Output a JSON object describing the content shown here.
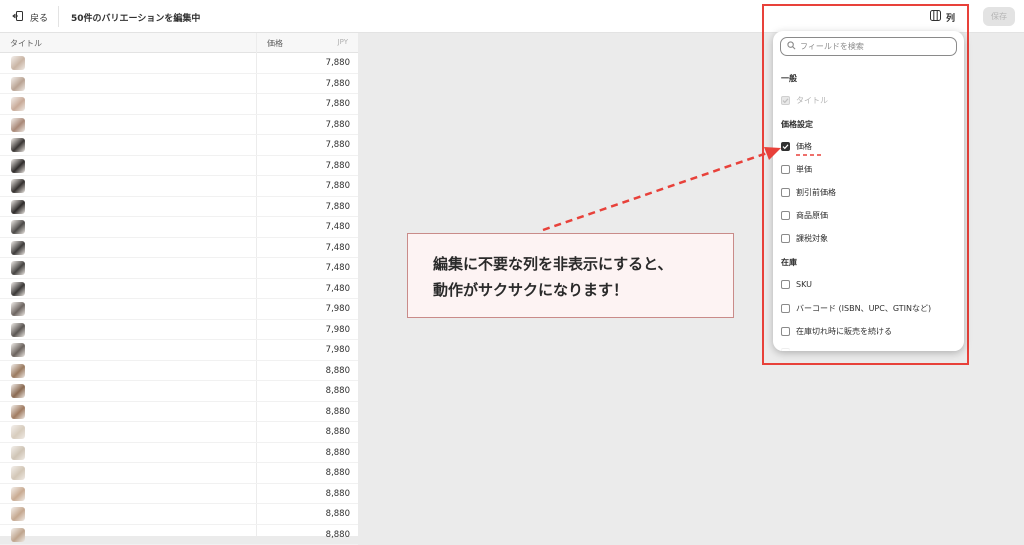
{
  "header": {
    "back_label": "戻る",
    "title": "50件のバリエーションを編集中",
    "columns_label": "列",
    "save_label": "保存"
  },
  "grid": {
    "col_title": "タイトル",
    "col_price": "価格",
    "currency": "JPY",
    "rows": [
      {
        "price": "7,880",
        "thumb": "#c9b4a4"
      },
      {
        "price": "7,880",
        "thumb": "#b9a393"
      },
      {
        "price": "7,880",
        "thumb": "#c8aa98"
      },
      {
        "price": "7,880",
        "thumb": "#a88877"
      },
      {
        "price": "7,880",
        "thumb": "#3a3634"
      },
      {
        "price": "7,880",
        "thumb": "#2f2c2b"
      },
      {
        "price": "7,880",
        "thumb": "#34302e"
      },
      {
        "price": "7,880",
        "thumb": "#2d2a29"
      },
      {
        "price": "7,480",
        "thumb": "#4a4846"
      },
      {
        "price": "7,480",
        "thumb": "#3d3b3a"
      },
      {
        "price": "7,480",
        "thumb": "#454341"
      },
      {
        "price": "7,480",
        "thumb": "#3a3837"
      },
      {
        "price": "7,980",
        "thumb": "#6c6460"
      },
      {
        "price": "7,980",
        "thumb": "#5a5552"
      },
      {
        "price": "7,980",
        "thumb": "#6a625d"
      },
      {
        "price": "8,880",
        "thumb": "#9a7a60"
      },
      {
        "price": "8,880",
        "thumb": "#8a6a52"
      },
      {
        "price": "8,880",
        "thumb": "#a07c62"
      },
      {
        "price": "8,880",
        "thumb": "#d7ccbd"
      },
      {
        "price": "8,880",
        "thumb": "#cfc4b5"
      },
      {
        "price": "8,880",
        "thumb": "#d2c6b6"
      },
      {
        "price": "8,880",
        "thumb": "#c9ab92"
      },
      {
        "price": "8,880",
        "thumb": "#c5a890"
      },
      {
        "price": "8,880",
        "thumb": "#bfa58e"
      }
    ]
  },
  "popover": {
    "search_placeholder": "フィールドを検索",
    "sections": {
      "general": "一般",
      "pricing": "価格設定",
      "inventory": "在庫"
    },
    "options": {
      "title": "タイトル",
      "price": "価格",
      "unit_price": "単価",
      "compare_at": "割引前価格",
      "cost": "商品原価",
      "taxable": "課税対象",
      "sku": "SKU",
      "barcode": "バーコード (ISBN、UPC、GTINなど)",
      "continue_selling": "在庫切れ時に販売を続ける"
    }
  },
  "callout": {
    "line1": "編集に不要な列を非表示にすると、",
    "line2": "動作がサクサクになります！"
  },
  "colors": {
    "annotation_red": "#e8413a",
    "callout_bg": "#fdf3f3"
  }
}
